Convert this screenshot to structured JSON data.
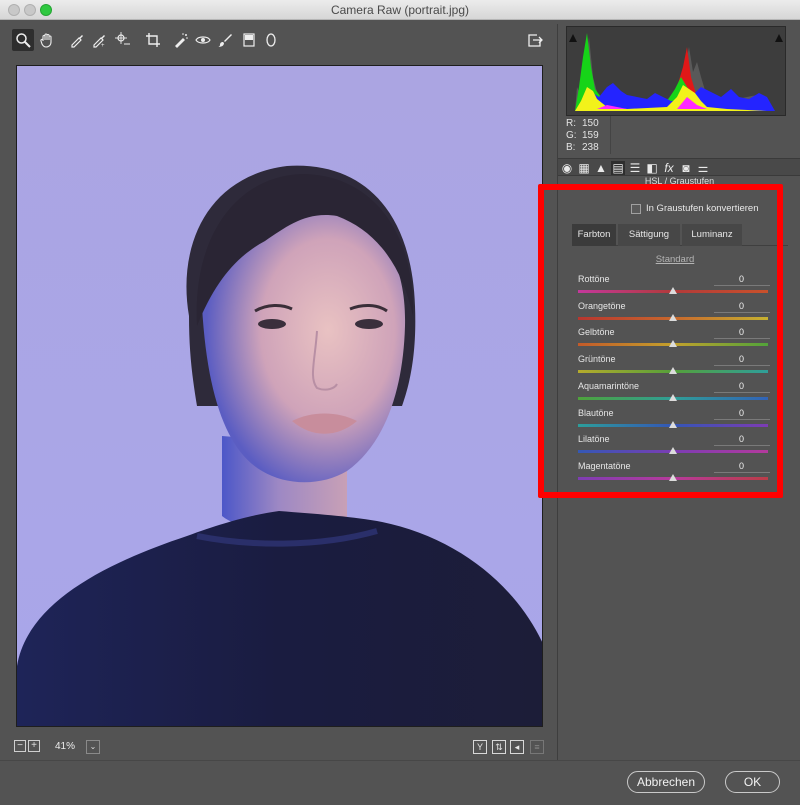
{
  "window": {
    "title": "Camera Raw (portrait.jpg)"
  },
  "toolbar": {
    "tools": [
      {
        "name": "zoom-tool-icon",
        "glyph": "🔍"
      },
      {
        "name": "hand-tool-icon",
        "glyph": "✋"
      },
      {
        "name": "white-balance-tool-icon",
        "glyph": "✎"
      },
      {
        "name": "color-sampler-icon",
        "glyph": "✎"
      },
      {
        "name": "targeted-adjustment-icon",
        "glyph": "⊙"
      },
      {
        "name": "crop-tool-icon",
        "glyph": "⌗"
      },
      {
        "name": "spot-removal-icon",
        "glyph": "✐"
      },
      {
        "name": "red-eye-icon",
        "glyph": "◉"
      },
      {
        "name": "adjustment-brush-icon",
        "glyph": "✏"
      },
      {
        "name": "graduated-filter-icon",
        "glyph": "▮"
      },
      {
        "name": "radial-filter-icon",
        "glyph": "◯"
      }
    ],
    "export_icon": "export-icon"
  },
  "statusbar": {
    "zoom": "41%",
    "zoom_out": "−",
    "zoom_in": "+",
    "dropdown": "⌄",
    "view_y": "Y",
    "view_swap": "⇅",
    "view_prev": "◂"
  },
  "histogram": {
    "r_label": "R:",
    "r": "150",
    "g_label": "G:",
    "g": "159",
    "b_label": "B:",
    "b": "238"
  },
  "panel": {
    "section_title": "HSL / Graustufen",
    "grayscale_label": "In Graustufen konvertieren",
    "tabs": [
      "Farbton",
      "Sättigung",
      "Luminanz"
    ],
    "active_tab": "Farbton",
    "standard_link": "Standard",
    "sliders": [
      {
        "label": "Rottöne",
        "value": "0",
        "gradient": [
          "#c3389c",
          "#b23a3a",
          "#c9512b"
        ]
      },
      {
        "label": "Orangetöne",
        "value": "0",
        "gradient": [
          "#b8362f",
          "#c7672d",
          "#c6b130"
        ]
      },
      {
        "label": "Gelbtöne",
        "value": "0",
        "gradient": [
          "#c35a29",
          "#c3a12c",
          "#52a33a"
        ]
      },
      {
        "label": "Grüntöne",
        "value": "0",
        "gradient": [
          "#b5ab2c",
          "#55a03a",
          "#2f9f9a"
        ]
      },
      {
        "label": "Aquamarintöne",
        "value": "0",
        "gradient": [
          "#4ea33b",
          "#2f9e96",
          "#3163b8"
        ]
      },
      {
        "label": "Blautöne",
        "value": "0",
        "gradient": [
          "#2c9e9b",
          "#3456b5",
          "#7d3cb4"
        ]
      },
      {
        "label": "Lilatöne",
        "value": "0",
        "gradient": [
          "#3458b5",
          "#7b3db4",
          "#b43a9d"
        ]
      },
      {
        "label": "Magentatöne",
        "value": "0",
        "gradient": [
          "#7e3db3",
          "#b63a9b",
          "#bb3c48"
        ]
      }
    ]
  },
  "footer": {
    "cancel": "Abbrechen",
    "ok": "OK"
  }
}
